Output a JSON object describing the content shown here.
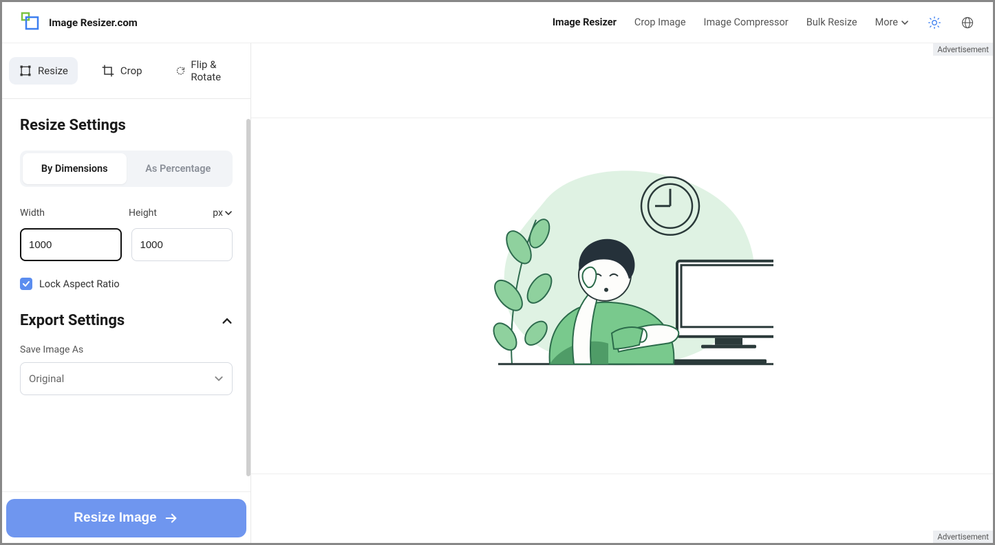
{
  "brand": {
    "name": "Image Resizer.com"
  },
  "nav": {
    "image_resizer": "Image Resizer",
    "crop_image": "Crop Image",
    "image_compressor": "Image Compressor",
    "bulk_resize": "Bulk Resize",
    "more": "More"
  },
  "tooltabs": {
    "resize": "Resize",
    "crop": "Crop",
    "flip_rotate": "Flip & Rotate"
  },
  "resize": {
    "title": "Resize Settings",
    "by_dimensions": "By Dimensions",
    "as_percentage": "As Percentage",
    "width_label": "Width",
    "height_label": "Height",
    "unit": "px",
    "width_value": "1000",
    "height_value": "1000",
    "lock_label": "Lock Aspect Ratio"
  },
  "export": {
    "title": "Export Settings",
    "save_as_label": "Save Image As",
    "format": "Original"
  },
  "cta": {
    "label": "Resize Image"
  },
  "ads": {
    "label": "Advertisement"
  }
}
